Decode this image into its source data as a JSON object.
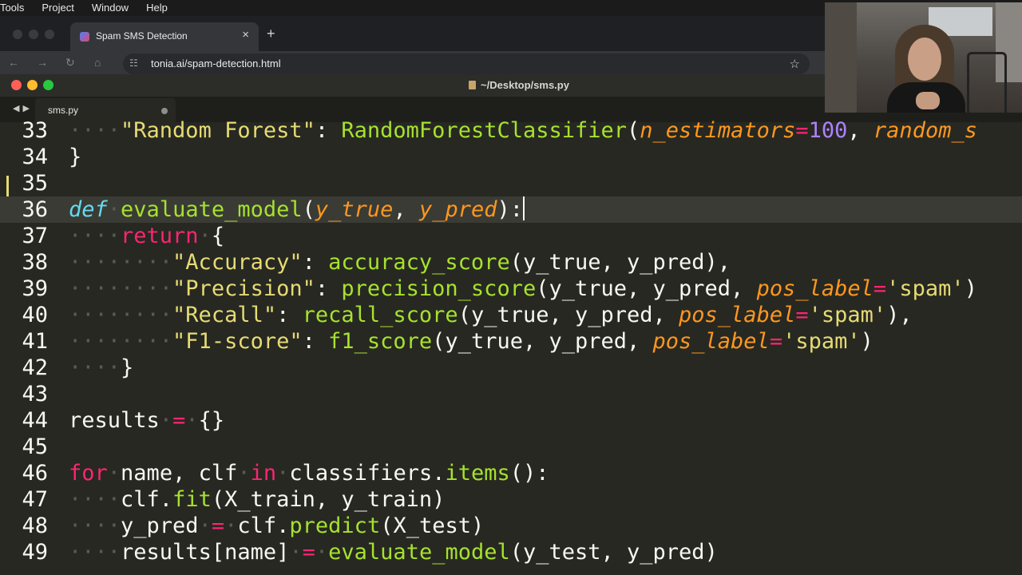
{
  "menubar": {
    "items": [
      "Tools",
      "Project",
      "Window",
      "Help"
    ]
  },
  "browser": {
    "tab_title": "Spam SMS Detection",
    "tab_close": "×",
    "new_tab": "+",
    "url": "tonia.ai/spam-detection.html",
    "icons": [
      "back-arrow-icon",
      "forward-arrow-icon",
      "reload-icon",
      "home-icon",
      "site-info-icon",
      "bookmark-star-icon"
    ]
  },
  "editor": {
    "window_title": "~/Desktop/sms.py",
    "file_tab": "sms.py",
    "active_line": "36",
    "theme_colors": {
      "background": "#272822",
      "keyword": "#f92672",
      "def": "#66d9ef",
      "function": "#a6e22e",
      "string": "#e6db74",
      "number": "#ae81ff",
      "parameter": "#fd971f"
    },
    "lines": [
      {
        "n": "33",
        "tokens": [
          [
            "ws",
            "····"
          ],
          [
            "st",
            "\"Random·Forest\""
          ],
          [
            "pl",
            ":·"
          ],
          [
            "fn",
            "RandomForestClassifier"
          ],
          [
            "pl",
            "("
          ],
          [
            "pm",
            "n_estimators"
          ],
          [
            "kw",
            "="
          ],
          [
            "nm",
            "100"
          ],
          [
            "pl",
            ",·"
          ],
          [
            "pm",
            "random_s"
          ]
        ]
      },
      {
        "n": "34",
        "tokens": [
          [
            "pl",
            "}"
          ]
        ]
      },
      {
        "n": "35",
        "tokens": []
      },
      {
        "n": "36",
        "tokens": [
          [
            "def",
            "def"
          ],
          [
            "ws",
            "·"
          ],
          [
            "fn",
            "evaluate_model"
          ],
          [
            "pl",
            "("
          ],
          [
            "pm",
            "y_true"
          ],
          [
            "pl",
            ",·"
          ],
          [
            "pm",
            "y_pred"
          ],
          [
            "pl",
            "):"
          ]
        ]
      },
      {
        "n": "37",
        "tokens": [
          [
            "ws",
            "····"
          ],
          [
            "kw",
            "return"
          ],
          [
            "ws",
            "·"
          ],
          [
            "pl",
            "{"
          ]
        ]
      },
      {
        "n": "38",
        "tokens": [
          [
            "ws",
            "········"
          ],
          [
            "st",
            "\"Accuracy\""
          ],
          [
            "pl",
            ":·"
          ],
          [
            "fn",
            "accuracy_score"
          ],
          [
            "pl",
            "(y_true,·y_pred),"
          ]
        ]
      },
      {
        "n": "39",
        "tokens": [
          [
            "ws",
            "········"
          ],
          [
            "st",
            "\"Precision\""
          ],
          [
            "pl",
            ":·"
          ],
          [
            "fn",
            "precision_score"
          ],
          [
            "pl",
            "(y_true,·y_pred,·"
          ],
          [
            "pm",
            "pos_label"
          ],
          [
            "kw",
            "="
          ],
          [
            "st",
            "'spam'"
          ],
          [
            "pl",
            ")"
          ]
        ]
      },
      {
        "n": "40",
        "tokens": [
          [
            "ws",
            "········"
          ],
          [
            "st",
            "\"Recall\""
          ],
          [
            "pl",
            ":·"
          ],
          [
            "fn",
            "recall_score"
          ],
          [
            "pl",
            "(y_true,·y_pred,·"
          ],
          [
            "pm",
            "pos_label"
          ],
          [
            "kw",
            "="
          ],
          [
            "st",
            "'spam'"
          ],
          [
            "pl",
            "),"
          ]
        ]
      },
      {
        "n": "41",
        "tokens": [
          [
            "ws",
            "········"
          ],
          [
            "st",
            "\"F1-score\""
          ],
          [
            "pl",
            ":·"
          ],
          [
            "fn",
            "f1_score"
          ],
          [
            "pl",
            "(y_true,·y_pred,·"
          ],
          [
            "pm",
            "pos_label"
          ],
          [
            "kw",
            "="
          ],
          [
            "st",
            "'spam'"
          ],
          [
            "pl",
            ")"
          ]
        ]
      },
      {
        "n": "42",
        "tokens": [
          [
            "ws",
            "····"
          ],
          [
            "pl",
            "}"
          ]
        ]
      },
      {
        "n": "43",
        "tokens": []
      },
      {
        "n": "44",
        "tokens": [
          [
            "pl",
            "results"
          ],
          [
            "ws",
            "·"
          ],
          [
            "kw",
            "="
          ],
          [
            "ws",
            "·"
          ],
          [
            "pl",
            "{}"
          ]
        ]
      },
      {
        "n": "45",
        "tokens": []
      },
      {
        "n": "46",
        "tokens": [
          [
            "kw",
            "for"
          ],
          [
            "ws",
            "·"
          ],
          [
            "pl",
            "name,·clf"
          ],
          [
            "ws",
            "·"
          ],
          [
            "kw",
            "in"
          ],
          [
            "ws",
            "·"
          ],
          [
            "pl",
            "classifiers."
          ],
          [
            "fn",
            "items"
          ],
          [
            "pl",
            "():"
          ]
        ]
      },
      {
        "n": "47",
        "tokens": [
          [
            "ws",
            "····"
          ],
          [
            "pl",
            "clf."
          ],
          [
            "fn",
            "fit"
          ],
          [
            "pl",
            "(X_train,·y_train)"
          ]
        ]
      },
      {
        "n": "48",
        "tokens": [
          [
            "ws",
            "····"
          ],
          [
            "pl",
            "y_pred"
          ],
          [
            "ws",
            "·"
          ],
          [
            "kw",
            "="
          ],
          [
            "ws",
            "·"
          ],
          [
            "pl",
            "clf."
          ],
          [
            "fn",
            "predict"
          ],
          [
            "pl",
            "(X_test)"
          ]
        ]
      },
      {
        "n": "49",
        "tokens": [
          [
            "ws",
            "····"
          ],
          [
            "pl",
            "results[name]"
          ],
          [
            "ws",
            "·"
          ],
          [
            "kw",
            "="
          ],
          [
            "ws",
            "·"
          ],
          [
            "fn",
            "evaluate_model"
          ],
          [
            "pl",
            "(y_test,·y_pred)"
          ]
        ]
      }
    ]
  },
  "webcam": {
    "description_icon": "presenter-webcam-icon"
  }
}
